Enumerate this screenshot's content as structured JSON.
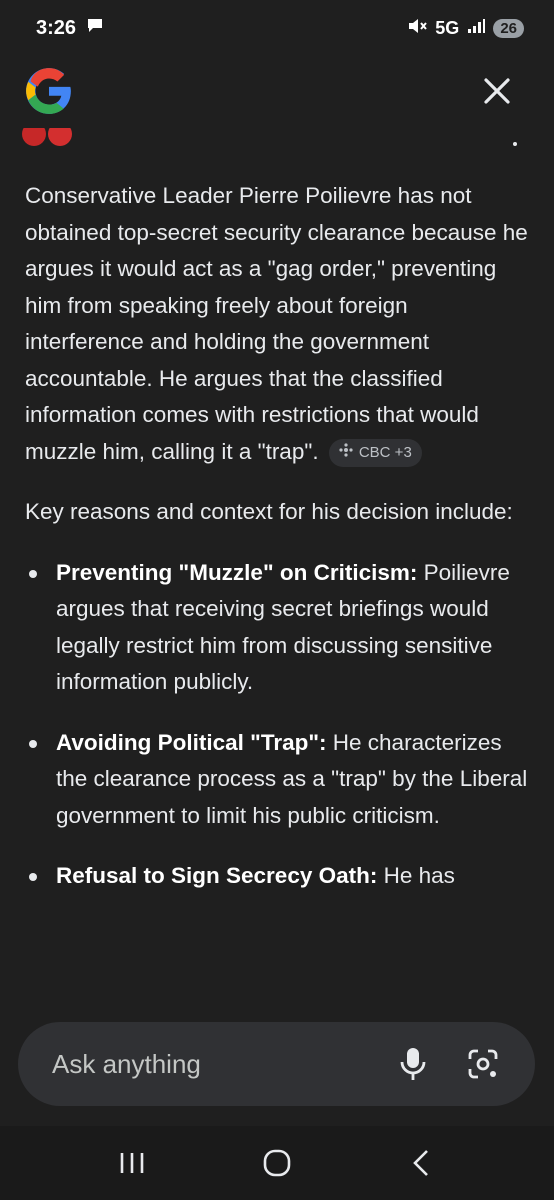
{
  "status": {
    "time": "3:26",
    "network": "5G",
    "battery": "26"
  },
  "header": {
    "logo_icon": "google-g-logo",
    "close_icon": "close-icon"
  },
  "answer": {
    "paragraph1": "Conservative Leader Pierre Poilievre has not obtained top-secret security clearance because he argues it would act as a \"gag order,\" preventing him from speaking freely about foreign interference and holding the government accountable. He argues that the classified information comes with restrictions that would muzzle him, calling it a \"trap\".",
    "source_chip": "CBC +3",
    "paragraph2": "Key reasons and context for his decision include:",
    "bullets": [
      {
        "title": "Preventing \"Muzzle\" on Criticism:",
        "text": " Poilievre argues that receiving secret briefings would legally restrict him from discussing sensitive information publicly."
      },
      {
        "title": "Avoiding Political \"Trap\":",
        "text": " He characterizes the clearance process as a \"trap\" by the Liberal government to limit his public criticism."
      },
      {
        "title": "Refusal to Sign Secrecy Oath:",
        "text": " He has"
      }
    ]
  },
  "askbar": {
    "placeholder": "Ask anything"
  },
  "colors": {
    "background": "#1f1f1f",
    "text": "#e8eaed",
    "askbar": "#303134"
  }
}
